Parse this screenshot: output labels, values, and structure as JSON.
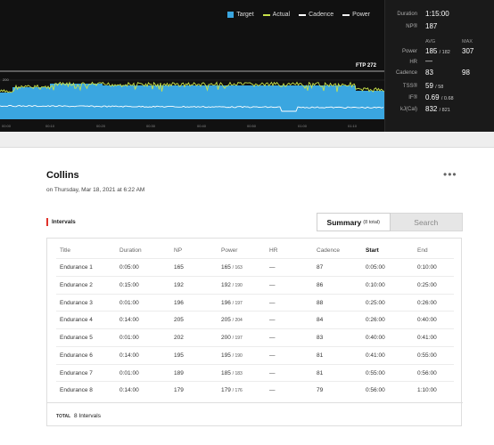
{
  "graph": {
    "legend": [
      {
        "label": "Target",
        "color": "#3aa6e0",
        "kind": "box"
      },
      {
        "label": "Actual",
        "color": "#c8e24a",
        "kind": "line"
      },
      {
        "label": "Cadence",
        "color": "#ffffff",
        "kind": "line"
      },
      {
        "label": "Power",
        "color": "#f0f0f0",
        "kind": "line"
      }
    ],
    "ftp_label": "FTP 272",
    "y_tick": "200",
    "x_ticks": [
      "00:00",
      "00:10",
      "00:20",
      "00:30",
      "00:40",
      "00:50",
      "01:00",
      "01:10"
    ]
  },
  "stats": {
    "duration_label": "Duration",
    "duration_value": "1:15:00",
    "np_label": "NP®",
    "np_value": "187",
    "avg_header": "AVG",
    "max_header": "MAX",
    "power_label": "Power",
    "power_avg": "185",
    "power_avg_target": "/ 182",
    "power_max": "307",
    "hr_label": "HR",
    "hr_avg": "—",
    "cadence_label": "Cadence",
    "cadence_avg": "83",
    "cadence_max": "98",
    "tss_label": "TSS®",
    "tss_value": "59",
    "tss_target": "/ 58",
    "if_label": "IF®",
    "if_value": "0.69",
    "if_target": "/ 0.68",
    "kj_label": "kJ(Cal)",
    "kj_value": "832",
    "kj_target": "/ 821"
  },
  "workout": {
    "title": "Collins",
    "date": "on Thursday, Mar 18, 2021 at 6:22 AM",
    "more_label": "•••"
  },
  "intervals": {
    "section_label": "Intervals",
    "summary_label": "Summary",
    "summary_count": "(8 total)",
    "search_label": "Search",
    "columns": [
      "Title",
      "Duration",
      "NP",
      "Power",
      "HR",
      "Cadence",
      "Start",
      "End"
    ],
    "rows": [
      {
        "title": "Endurance 1",
        "duration": "0:05:00",
        "np": "165",
        "power": "165",
        "power_target": "/ 163",
        "hr": "—",
        "cadence": "87",
        "start": "0:05:00",
        "end": "0:10:00"
      },
      {
        "title": "Endurance 2",
        "duration": "0:15:00",
        "np": "192",
        "power": "192",
        "power_target": "/ 190",
        "hr": "—",
        "cadence": "86",
        "start": "0:10:00",
        "end": "0:25:00"
      },
      {
        "title": "Endurance 3",
        "duration": "0:01:00",
        "np": "196",
        "power": "196",
        "power_target": "/ 197",
        "hr": "—",
        "cadence": "88",
        "start": "0:25:00",
        "end": "0:26:00"
      },
      {
        "title": "Endurance 4",
        "duration": "0:14:00",
        "np": "205",
        "power": "205",
        "power_target": "/ 204",
        "hr": "—",
        "cadence": "84",
        "start": "0:26:00",
        "end": "0:40:00"
      },
      {
        "title": "Endurance 5",
        "duration": "0:01:00",
        "np": "202",
        "power": "200",
        "power_target": "/ 197",
        "hr": "—",
        "cadence": "83",
        "start": "0:40:00",
        "end": "0:41:00"
      },
      {
        "title": "Endurance 6",
        "duration": "0:14:00",
        "np": "195",
        "power": "195",
        "power_target": "/ 190",
        "hr": "—",
        "cadence": "81",
        "start": "0:41:00",
        "end": "0:55:00"
      },
      {
        "title": "Endurance 7",
        "duration": "0:01:00",
        "np": "189",
        "power": "185",
        "power_target": "/ 183",
        "hr": "—",
        "cadence": "81",
        "start": "0:55:00",
        "end": "0:56:00"
      },
      {
        "title": "Endurance 8",
        "duration": "0:14:00",
        "np": "179",
        "power": "179",
        "power_target": "/ 176",
        "hr": "—",
        "cadence": "79",
        "start": "0:56:00",
        "end": "1:10:00"
      }
    ],
    "total_label": "TOTAL",
    "total_value": "8 Intervals"
  }
}
